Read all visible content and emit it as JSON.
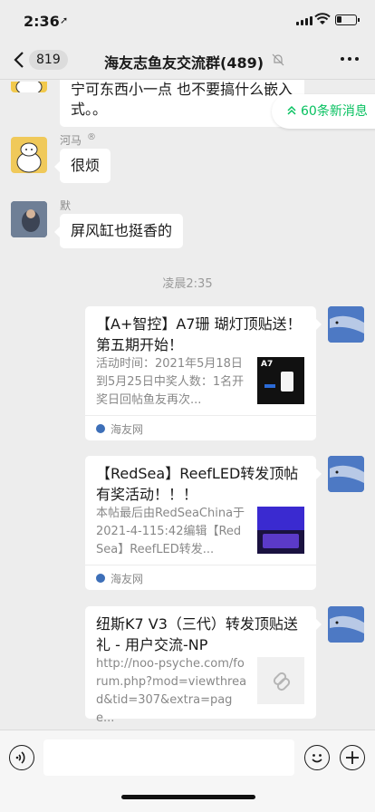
{
  "status_bar": {
    "time": "2:36",
    "location_glyph": "➚",
    "battery_level": 0.25
  },
  "nav": {
    "unread_count": "819",
    "title": "海友志鱼友交流群(489)",
    "mute_icon": "bell-slash-icon",
    "more_icon": "ellipsis-icon"
  },
  "new_messages": {
    "label": "60条新消息",
    "icon": "double-chevron-up-icon"
  },
  "messages": [
    {
      "sender": "",
      "text": "宁可东西小一点 也不要搞什么嵌入式。。"
    },
    {
      "sender": "河马",
      "sender_mark": "®",
      "text": "很烦"
    },
    {
      "sender": "默",
      "text": "屏风缸也挺香的"
    }
  ],
  "timestamp": "凌晨2:35",
  "cards": [
    {
      "title": "【A+智控】A7珊 瑚灯顶贴送！第五期开始！",
      "desc": "活动时间：2021年5月18日到5月25日中奖人数：1名开奖日回帖鱼友再次...",
      "thumb_label": "A7",
      "source": "海友网"
    },
    {
      "title": "【RedSea】ReefLED转发顶帖有奖活动！！！",
      "desc": "本帖最后由RedSeaChina于2021-4-115:42编辑【RedSea】ReefLED转发...",
      "thumb_label": "",
      "source": "海友网"
    },
    {
      "title": "纽斯K7 V3（三代）转发顶贴送礼 - 用户交流-NP",
      "desc": "http://noo-psyche.com/forum.php?mod=viewthread&tid=307&extra=page...",
      "thumb_label": "",
      "thumb_icon": "link-icon",
      "source": ""
    }
  ],
  "input_bar": {
    "voice_icon": "voice-icon",
    "emoji_icon": "emoji-icon",
    "plus_icon": "plus-icon"
  }
}
